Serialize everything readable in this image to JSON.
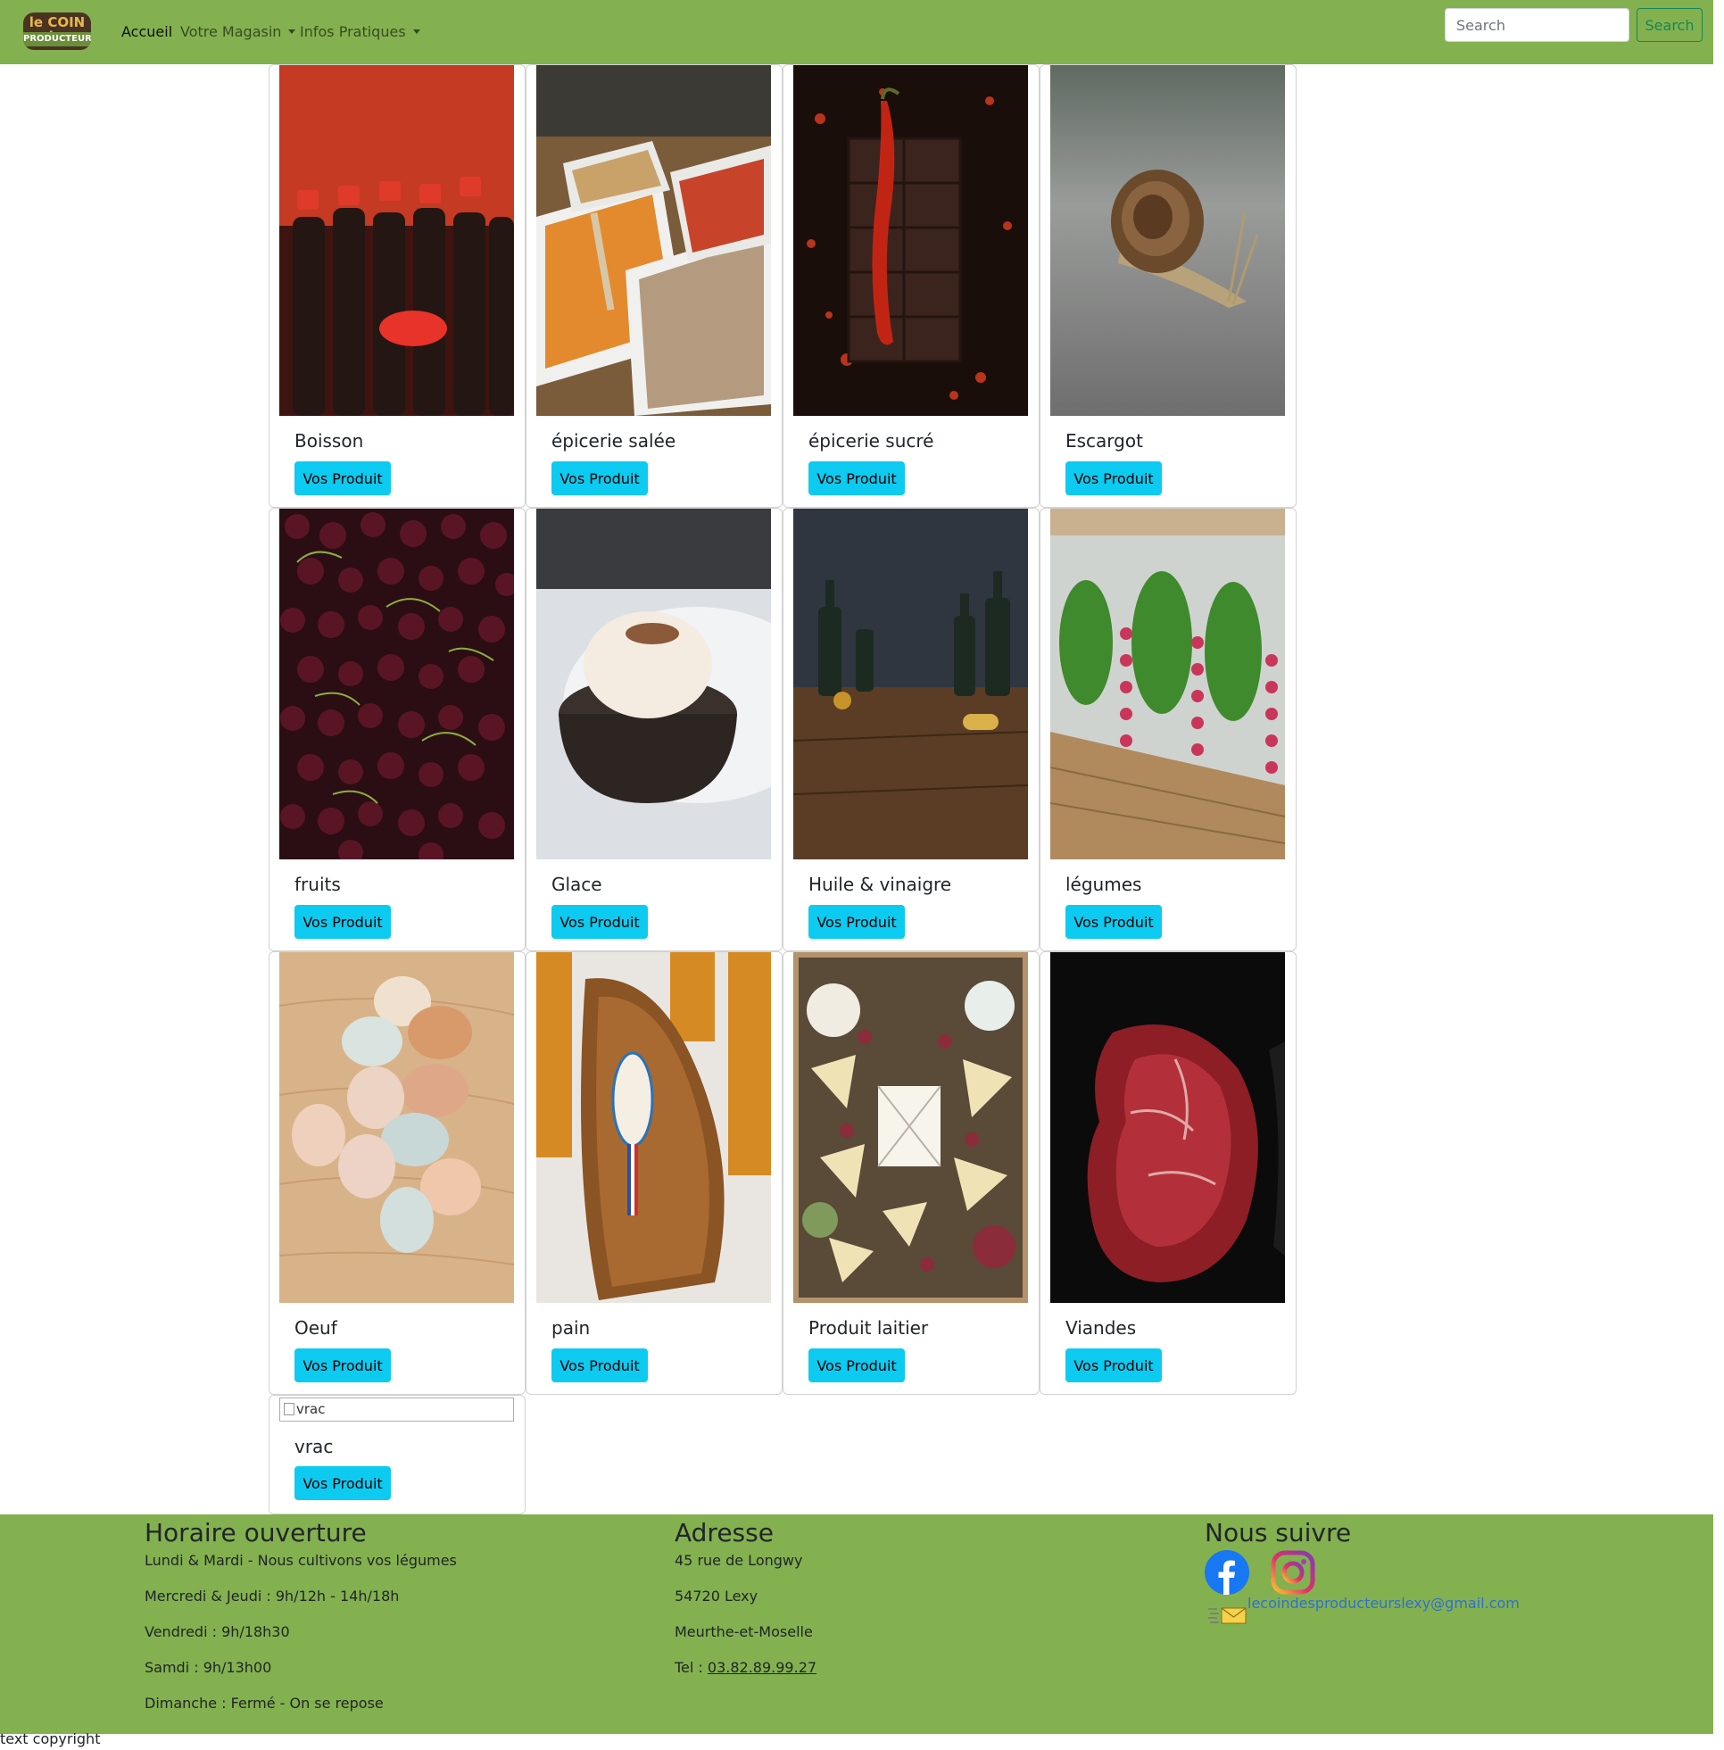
{
  "navbar": {
    "logo_line1": "le COIN des",
    "logo_line2": "PRODUCTEURS",
    "links": [
      {
        "label": "Accueil"
      },
      {
        "label": "Votre Magasin"
      },
      {
        "label": "Infos Pratiques"
      }
    ],
    "search_placeholder": "Search",
    "search_button": "Search",
    "bg_color": "#83b14f"
  },
  "products": [
    {
      "title": "Boisson",
      "button": "Vos Produit",
      "image": "red-capped-bottles"
    },
    {
      "title": "épicerie salée",
      "button": "Vos Produit",
      "image": "spice-trays"
    },
    {
      "title": "épicerie sucré",
      "button": "Vos Produit",
      "image": "chocolate-bar-with-chili"
    },
    {
      "title": "Escargot",
      "button": "Vos Produit",
      "image": "snail-on-asphalt"
    },
    {
      "title": "fruits",
      "button": "Vos Produit",
      "image": "cherries"
    },
    {
      "title": "Glace",
      "button": "Vos Produit",
      "image": "ice-cream-in-pot"
    },
    {
      "title": "Huile & vinaigre",
      "button": "Vos Produit",
      "image": "oil-bottles-on-table"
    },
    {
      "title": "légumes",
      "button": "Vos Produit",
      "image": "radishes-and-lettuce-crate"
    },
    {
      "title": "Oeuf",
      "button": "Vos Produit",
      "image": "eggs-on-wood"
    },
    {
      "title": "pain",
      "button": "Vos Produit",
      "image": "gingerbread-loaf"
    },
    {
      "title": "Produit laitier",
      "button": "Vos Produit",
      "image": "cheese-platter"
    },
    {
      "title": "Viandes",
      "button": "Vos Produit",
      "image": "raw-beef-cut"
    },
    {
      "title": "vrac",
      "button": "Vos Produit",
      "image_alt": "vrac"
    }
  ],
  "footer": {
    "hours": {
      "heading": "Horaire ouverture",
      "lines": [
        "Lundi & Mardi - Nous cultivons vos légumes",
        "Mercredi & Jeudi : 9h/12h - 14h/18h",
        "Vendredi : 9h/18h30",
        "Samdi : 9h/13h00",
        "Dimanche : Fermé - On se repose"
      ]
    },
    "address": {
      "heading": "Adresse",
      "lines": [
        "45 rue de Longwy",
        "54720 Lexy",
        "Meurthe-et-Moselle"
      ],
      "tel_label": "Tel : ",
      "tel_number": "03.82.89.99.27"
    },
    "social": {
      "heading": "Nous suivre",
      "facebook_icon": "facebook-icon",
      "instagram_icon": "instagram-icon",
      "email": "lecoindesproducteurslexy@gmail.com"
    }
  },
  "copyright": "text copyright"
}
